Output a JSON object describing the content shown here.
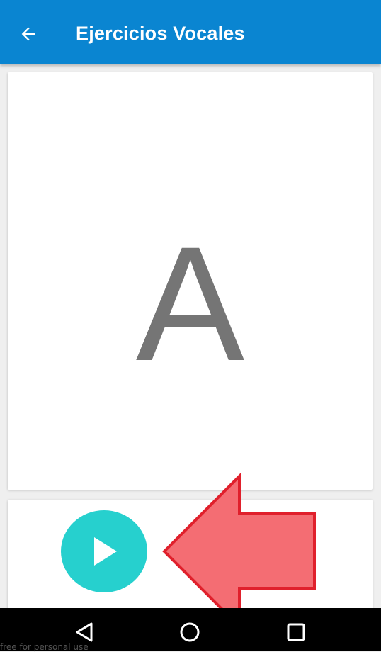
{
  "appbar": {
    "title": "Ejercicios Vocales",
    "back_icon": "arrow-left-icon",
    "color": "#0a85d1"
  },
  "card": {
    "letter": "A",
    "letter_color": "#757575"
  },
  "controls": {
    "play_icon": "play-icon",
    "play_color": "#26d0ce"
  },
  "annotation": {
    "shape": "arrow-left-icon",
    "fill": "#f46d73",
    "stroke": "#e0202c"
  },
  "navbar": {
    "back_icon": "triangle-back-icon",
    "home_icon": "circle-home-icon",
    "recent_icon": "square-recent-icon"
  },
  "watermark": {
    "text": "free for personal use"
  }
}
